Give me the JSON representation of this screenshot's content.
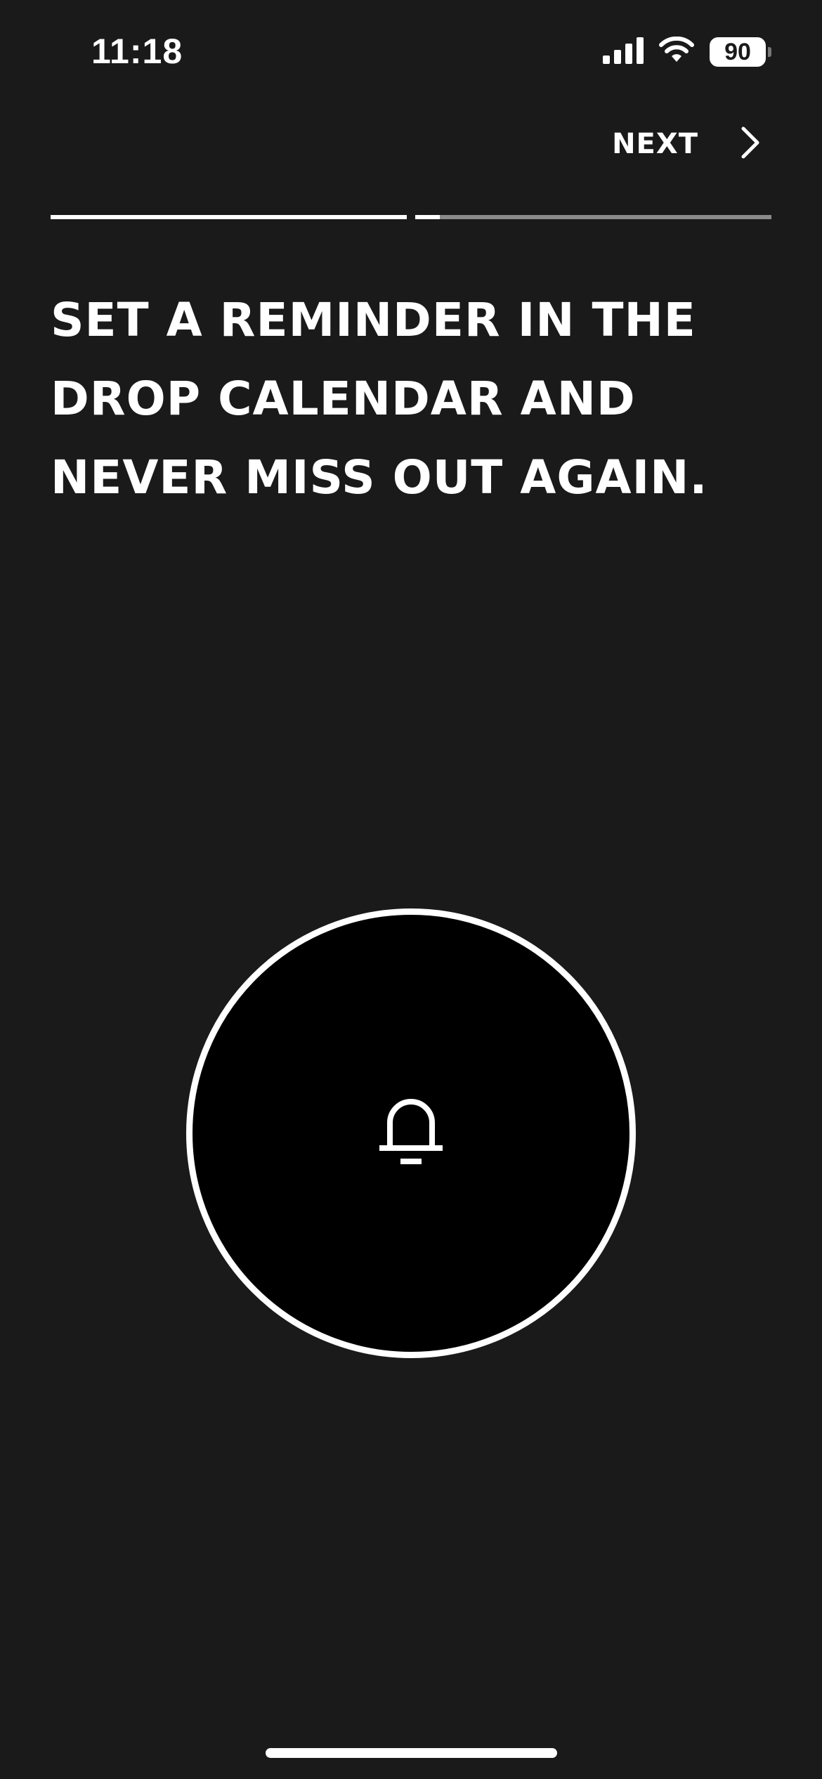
{
  "status_bar": {
    "time": "11:18",
    "battery_level": "90",
    "icons": [
      "cellular-signal-icon",
      "wifi-icon",
      "battery-icon"
    ]
  },
  "nav": {
    "next_label": "NEXT",
    "next_icon": "chevron-right-icon"
  },
  "progress": {
    "segments": [
      {
        "fill": 1.0
      },
      {
        "fill": 0.07
      }
    ]
  },
  "headline": "SET A REMINDER IN THE DROP CALENDAR AND NEVER MISS OUT AGAIN.",
  "reminder_button": {
    "icon": "bell-icon"
  },
  "colors": {
    "background": "#1a1a1a",
    "foreground": "#ffffff",
    "button_fill": "#000000",
    "progress_track": "#8a8a8a"
  }
}
